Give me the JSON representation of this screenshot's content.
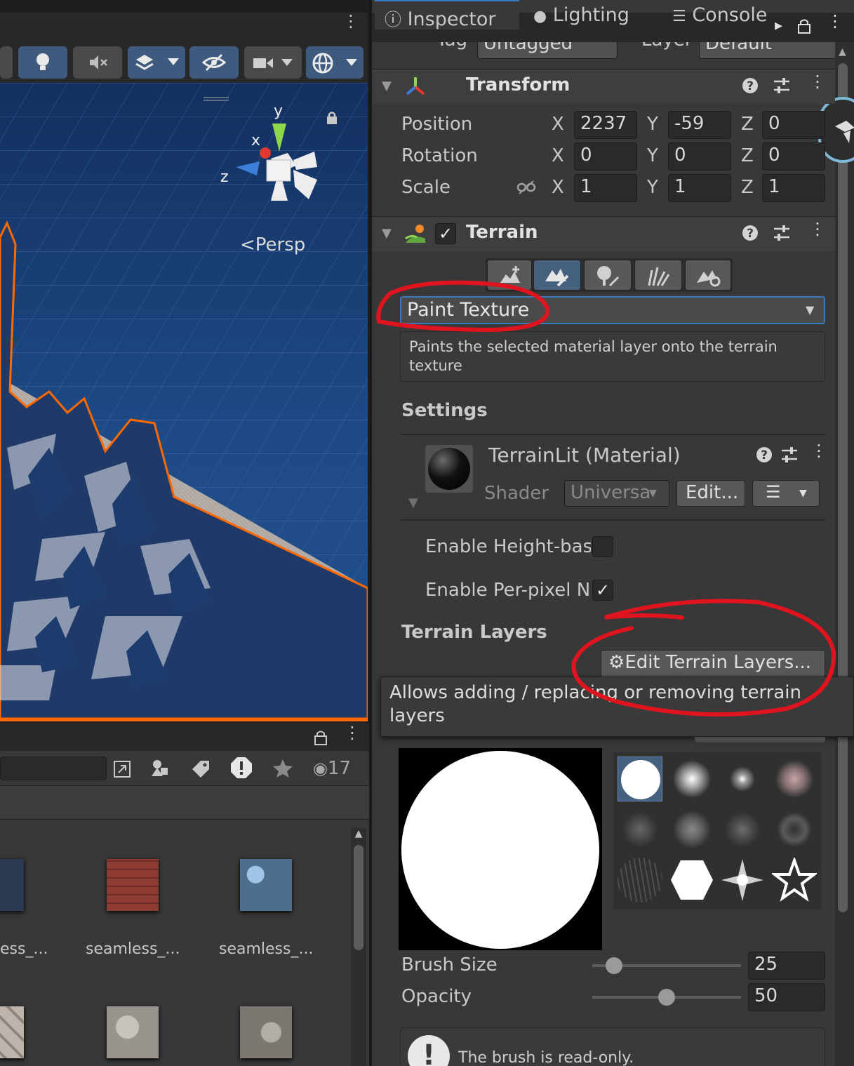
{
  "tabs": [
    {
      "label": "Inspector",
      "active": true
    },
    {
      "label": "Lighting",
      "active": false
    },
    {
      "label": "Console",
      "active": false
    }
  ],
  "top_fields": {
    "tag_label": "Tag",
    "tag_value": "Untagged",
    "layer_label": "Layer",
    "layer_value": "Default"
  },
  "scene": {
    "persp_label": "Persp",
    "gizmo": {
      "x": "x",
      "y": "y",
      "z": "z"
    }
  },
  "transform": {
    "title": "Transform",
    "rows": [
      {
        "label": "Position",
        "x": "2237",
        "y": "-59",
        "z": "0"
      },
      {
        "label": "Rotation",
        "x": "0",
        "y": "0",
        "z": "0"
      },
      {
        "label": "Scale",
        "x": "1",
        "y": "1",
        "z": "1"
      }
    ],
    "axis": {
      "x": "X",
      "y": "Y",
      "z": "Z"
    }
  },
  "terrain": {
    "title": "Terrain",
    "enabled": true,
    "tool_dropdown": "Paint Texture",
    "tool_description": "Paints the selected material layer onto the terrain texture",
    "settings_title": "Settings",
    "material_name": "TerrainLit (Material)",
    "shader_label": "Shader",
    "shader_value": "Universa",
    "edit_label": "Edit...",
    "height_blend_label": "Enable Height-bas",
    "height_blend_checked": false,
    "per_pixel_label": "Enable Per-pixel N",
    "per_pixel_checked": true,
    "layers_title": "Terrain Layers",
    "edit_layers_label": "Edit Terrain Layers...",
    "tooltip": "Allows adding / replacing or removing terrain layers",
    "brush_size_label": "Brush Size",
    "brush_size_value": "25",
    "brush_size_fraction": 0.1,
    "opacity_label": "Opacity",
    "opacity_value": "50",
    "opacity_fraction": 0.5,
    "notice": "The brush is read-only."
  },
  "project": {
    "visible_count": "17",
    "assets": [
      "ess_...",
      "seamless_...",
      "seamless_..."
    ]
  },
  "colors": {
    "accent": "#3a79bb",
    "annotation": "#e0141e",
    "selection_outline": "#ff6a00"
  }
}
